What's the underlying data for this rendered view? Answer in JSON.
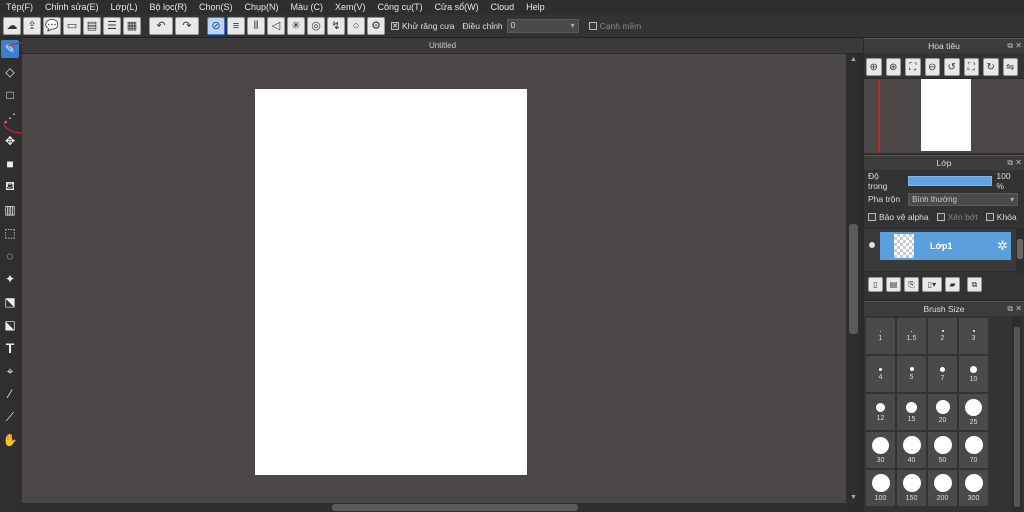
{
  "menu": [
    "Tệp(F)",
    "Chỉnh sửa(E)",
    "Lớp(L)",
    "Bộ lọc(R)",
    "Chọn(S)",
    "Chụp(N)",
    "Màu (C)",
    "Xem(V)",
    "Công cụ(T)",
    "Cửa sổ(W)",
    "Cloud",
    "Help"
  ],
  "toolbar": {
    "antialias_label": "Khử răng cưa",
    "adjust_label": "Điều chỉnh",
    "adjust_value": "0",
    "soft_edge_label": "Cạnh mềm"
  },
  "document": {
    "tab_title": "Untitled"
  },
  "navigator": {
    "title": "Hoa tiêu"
  },
  "layers": {
    "title": "Lớp",
    "opacity_label": "Độ trong",
    "opacity_value": "100 %",
    "blend_label": "Pha trộn",
    "blend_value": "Bình thường",
    "protect_alpha_label": "Bảo vệ alpha",
    "clipping_label": "Xén bớt",
    "lock_label": "Khóa",
    "layer_name": "Lớp1"
  },
  "brush": {
    "title": "Brush Size",
    "sizes": [
      "1",
      "1.5",
      "2",
      "3",
      "4",
      "5",
      "7",
      "10",
      "12",
      "15",
      "20",
      "25",
      "30",
      "40",
      "50",
      "70",
      "100",
      "150",
      "200",
      "300"
    ]
  },
  "colors": {
    "accent": "#3d7fd0",
    "layer_selected": "#5aa0dc",
    "canvas_bg": "#4b4747",
    "annotation": "#c0262c"
  }
}
